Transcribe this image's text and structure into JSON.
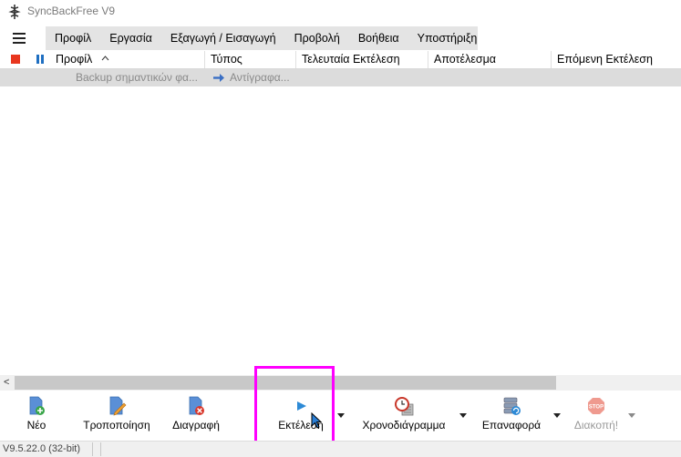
{
  "window": {
    "title": "SyncBackFree V9"
  },
  "menu": {
    "items": [
      "Προφίλ",
      "Εργασία",
      "Εξαγωγή / Εισαγωγή",
      "Προβολή",
      "Βοήθεια",
      "Υποστήριξη"
    ]
  },
  "columns": {
    "profile": "Προφίλ",
    "type": "Τύπος",
    "last_run": "Τελευταία Εκτέλεση",
    "result": "Αποτέλεσμα",
    "next_run": "Επόμενη Εκτέλεση"
  },
  "rows": [
    {
      "profile": "Backup σημαντικών φα...",
      "type": "Αντίγραφα..."
    }
  ],
  "toolbar": {
    "new": "Νέο",
    "modify": "Τροποποίηση",
    "delete": "Διαγραφή",
    "run": "Εκτέλεση",
    "schedule": "Χρονοδιάγραμμα",
    "restore": "Επαναφορά",
    "stop": "Διακοπή!"
  },
  "status": {
    "version": "V9.5.22.0 (32-bit)"
  },
  "icons": {
    "stop": "STOP"
  },
  "colors": {
    "highlight": "#ff00ff",
    "menu_bg": "#e4e4e4",
    "row_bg": "#dcdcdc",
    "stop_red": "#e8361e",
    "pause_blue": "#1f6fc1"
  }
}
